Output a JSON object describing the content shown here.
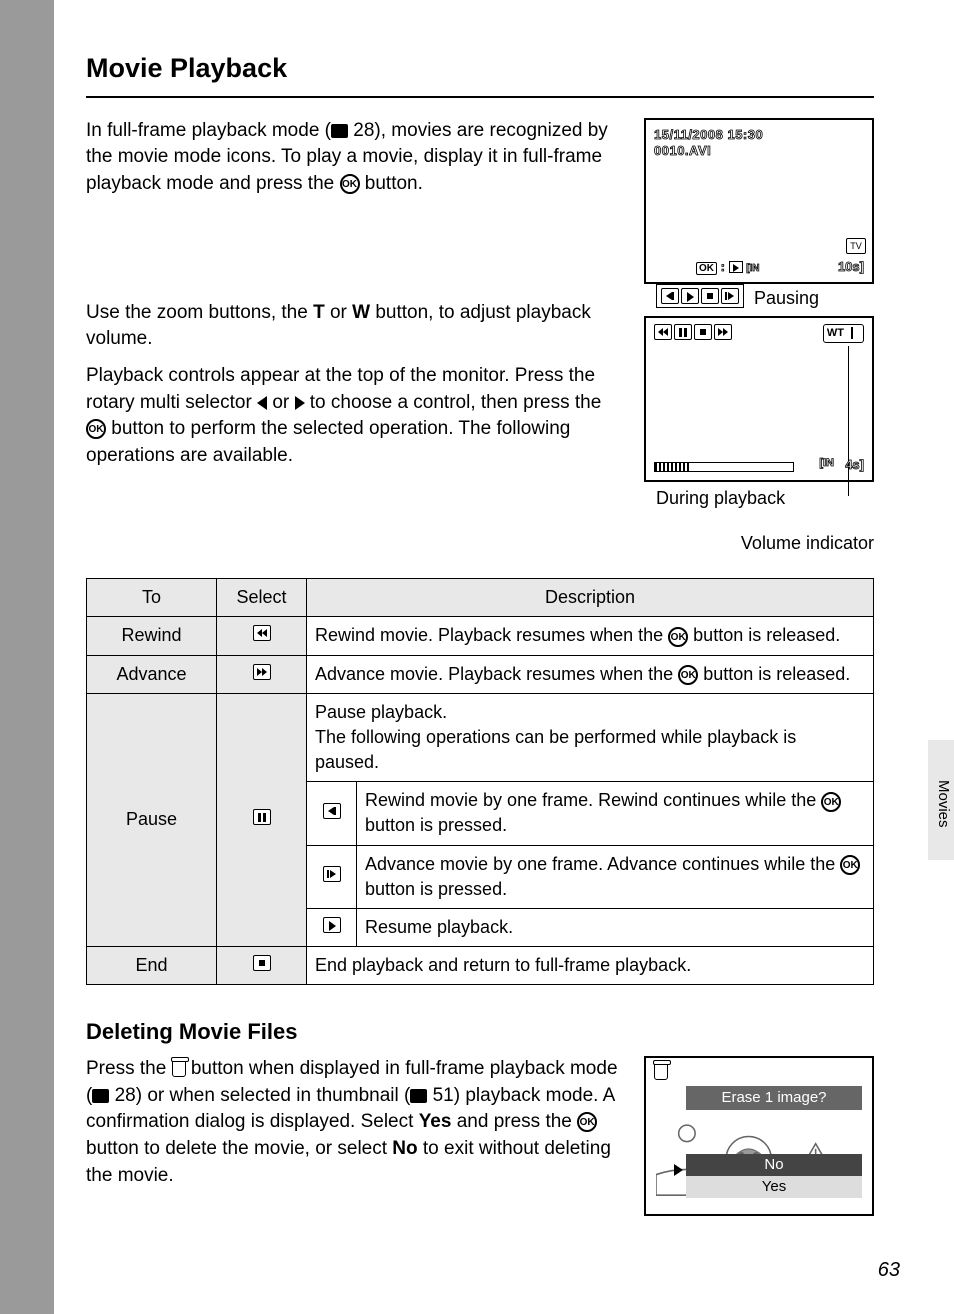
{
  "title": "Movie Playback",
  "intro": {
    "p1_a": "In full-frame playback mode (",
    "p1_ref": " 28), movies are recognized by the movie mode icons. To play a movie, display it in full-frame playback mode and press the ",
    "p1_b": " button.",
    "p2_a": "Use the zoom buttons, the ",
    "p2_t": "T",
    "p2_mid": " or ",
    "p2_w": "W",
    "p2_b": " button, to adjust playback volume.",
    "p3_a": "Playback controls appear at the top of the monitor. Press the rotary multi selector ",
    "p3_mid": " or ",
    "p3_b": " to choose a control, then press the ",
    "p3_c": " button to perform the selected operation. The following operations are available."
  },
  "screen1": {
    "timestamp": "15/11/2008 15:30",
    "filename": "0010.AVI",
    "ok_label": "OK",
    "in_label": "IN",
    "duration": "10s"
  },
  "screen2": {
    "pausing": "Pausing",
    "w": "W",
    "t": "T",
    "in": "IN",
    "time": "4s",
    "during": "During playback",
    "volume": "Volume indicator"
  },
  "table": {
    "h1": "To",
    "h2": "Select",
    "h3": "Description",
    "rows": {
      "rewind": {
        "label": "Rewind",
        "desc_a": "Rewind movie. Playback resumes when the ",
        "desc_b": " button is released."
      },
      "advance": {
        "label": "Advance",
        "desc_a": "Advance movie. Playback resumes when the ",
        "desc_b": " button is released."
      },
      "pause": {
        "label": "Pause",
        "desc_intro": "Pause playback.\nThe following operations can be performed while playback is paused.",
        "sub1_a": "Rewind movie by one frame. Rewind continues while the ",
        "sub1_b": " button is pressed.",
        "sub2_a": "Advance movie by one frame. Advance continues while the ",
        "sub2_b": " button is pressed.",
        "sub3": "Resume playback."
      },
      "end": {
        "label": "End",
        "desc": "End playback and return to full-frame playback."
      }
    }
  },
  "subsection": "Deleting Movie Files",
  "delete": {
    "p_a": "Press the ",
    "p_b": " button when displayed in full-frame playback mode (",
    "p_ref1": " 28) or when selected in thumbnail (",
    "p_ref2": " 51) playback mode. A confirmation dialog is displayed. Select ",
    "p_yes": "Yes",
    "p_c": " and press the ",
    "p_d": " button to delete the movie, or select ",
    "p_no": "No",
    "p_e": " to exit without deleting the movie."
  },
  "delete_screen": {
    "title": "Erase 1 image?",
    "no": "No",
    "yes": "Yes"
  },
  "side_tab": "Movies",
  "page_number": "63"
}
